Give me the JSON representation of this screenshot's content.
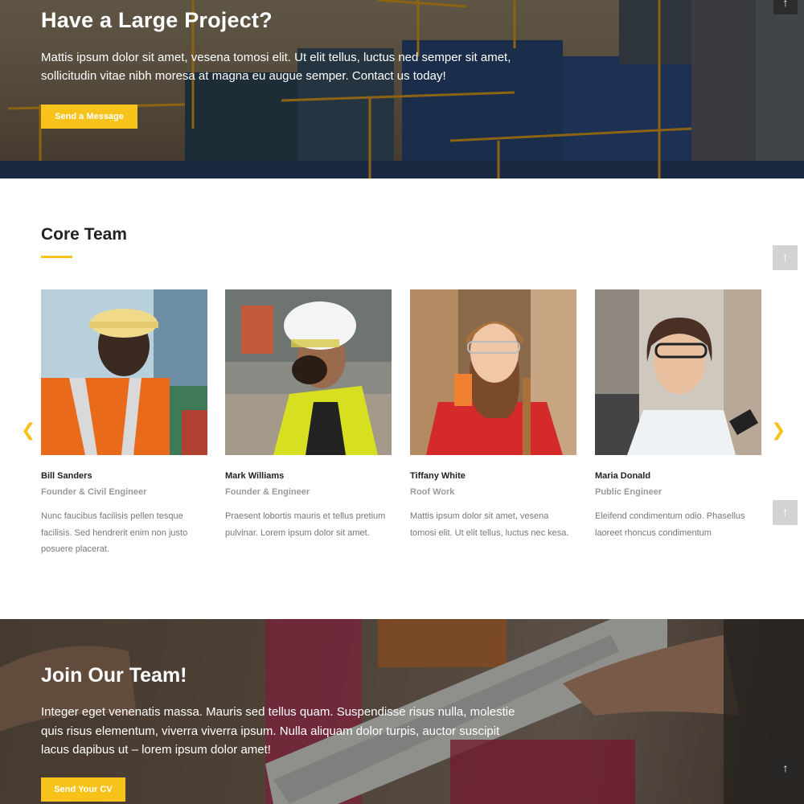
{
  "hero": {
    "title": "Have a Large Project?",
    "text": "Mattis ipsum dolor sit amet, vesena tomosi elit. Ut elit tellus, luctus ned semper sit amet, sollicitudin vitae nibh moresa at magna eu augue semper. Contact us today!",
    "button_label": "Send a Message"
  },
  "team": {
    "title": "Core Team",
    "members": [
      {
        "name": "Bill Sanders",
        "role": "Founder & Civil Engineer",
        "bio": "Nunc faucibus facilisis pellen tesque facilisis. Sed hendrerit enim non justo posuere placerat."
      },
      {
        "name": "Mark Williams",
        "role": "Founder & Engineer",
        "bio": "Praesent lobortis mauris et tellus pretium pulvinar. Lorem ipsum dolor sit amet."
      },
      {
        "name": "Tiffany White",
        "role": "Roof Work",
        "bio": "Mattis ipsum dolor sit amet, vesena tomosi elit. Ut elit tellus, luctus nec kesa."
      },
      {
        "name": "Maria Donald",
        "role": "Public Engineer",
        "bio": "Eleifend condimentum odio. Phasellus laoreet rhoncus condimentum"
      }
    ],
    "prev_icon": "chevron-left-icon",
    "next_icon": "chevron-right-icon"
  },
  "join": {
    "title": "Join Our Team!",
    "text": "Integer eget venenatis massa. Mauris sed tellus quam. Suspendisse risus nulla, molestie quis risus elementum, viverra viverra ipsum. Nulla aliquam dolor turpis, auctor suscipit lacus dapibus ut – lorem ipsum dolor amet!",
    "button_label": "Send Your CV"
  },
  "colors": {
    "accent": "#f7c21a",
    "heading": "#222222",
    "muted": "#9a9a9a",
    "body_text": "#777777"
  },
  "icons": {
    "scroll_top": "arrow-up-icon"
  }
}
